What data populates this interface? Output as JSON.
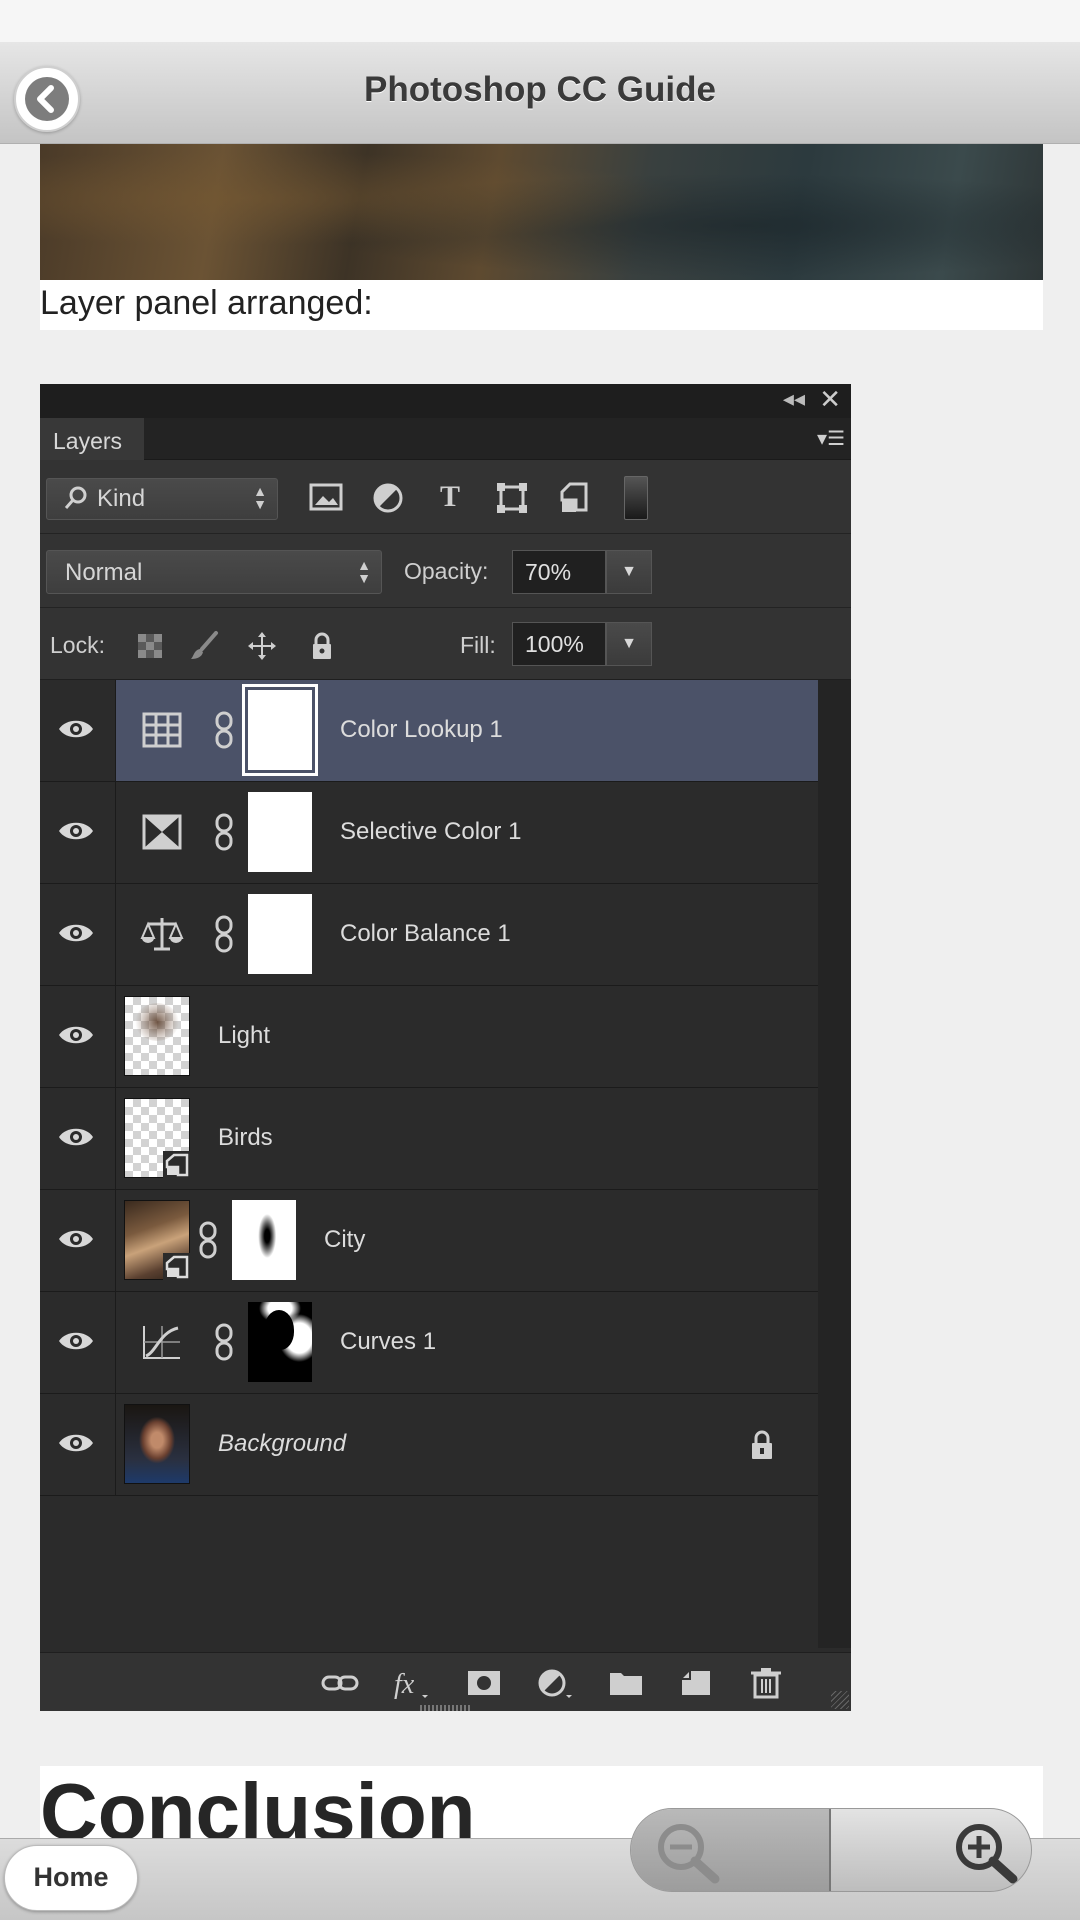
{
  "header": {
    "title": "Photoshop CC Guide",
    "back_icon": "chevron-left-icon"
  },
  "content": {
    "caption": "Layer panel arranged:",
    "conclusion_heading": "Conclusion"
  },
  "layers_panel": {
    "tab_label": "Layers",
    "filter": {
      "kind_label": "Kind",
      "filter_icons": [
        "image-filter-icon",
        "adjustment-filter-icon",
        "type-filter-icon",
        "shape-filter-icon",
        "smart-object-filter-icon",
        "filter-toggle-icon"
      ]
    },
    "blend_mode": "Normal",
    "opacity_label": "Opacity:",
    "opacity_value": "70%",
    "lock_label": "Lock:",
    "fill_label": "Fill:",
    "fill_value": "100%",
    "layers": [
      {
        "name": "Color Lookup 1",
        "kind": "adjustment",
        "icon": "color-lookup-icon",
        "selected": true,
        "visible": true
      },
      {
        "name": "Selective Color 1",
        "kind": "adjustment",
        "icon": "selective-color-icon",
        "selected": false,
        "visible": true
      },
      {
        "name": "Color Balance 1",
        "kind": "adjustment",
        "icon": "color-balance-icon",
        "selected": false,
        "visible": true
      },
      {
        "name": "Light",
        "kind": "pixel",
        "selected": false,
        "visible": true
      },
      {
        "name": "Birds",
        "kind": "smart-object",
        "selected": false,
        "visible": true
      },
      {
        "name": "City",
        "kind": "smart-object-masked",
        "selected": false,
        "visible": true
      },
      {
        "name": "Curves 1",
        "kind": "adjustment",
        "icon": "curves-icon",
        "selected": false,
        "visible": true
      },
      {
        "name": "Background",
        "kind": "background",
        "locked": true,
        "selected": false,
        "visible": true
      }
    ],
    "bottom_icons": [
      "link-layers-icon",
      "fx-icon",
      "add-mask-icon",
      "new-adjustment-icon",
      "new-group-icon",
      "new-layer-icon",
      "delete-layer-icon"
    ]
  },
  "bottom_bar": {
    "home_label": "Home",
    "zoom_out_icon": "zoom-out-icon",
    "zoom_in_icon": "zoom-in-icon"
  }
}
